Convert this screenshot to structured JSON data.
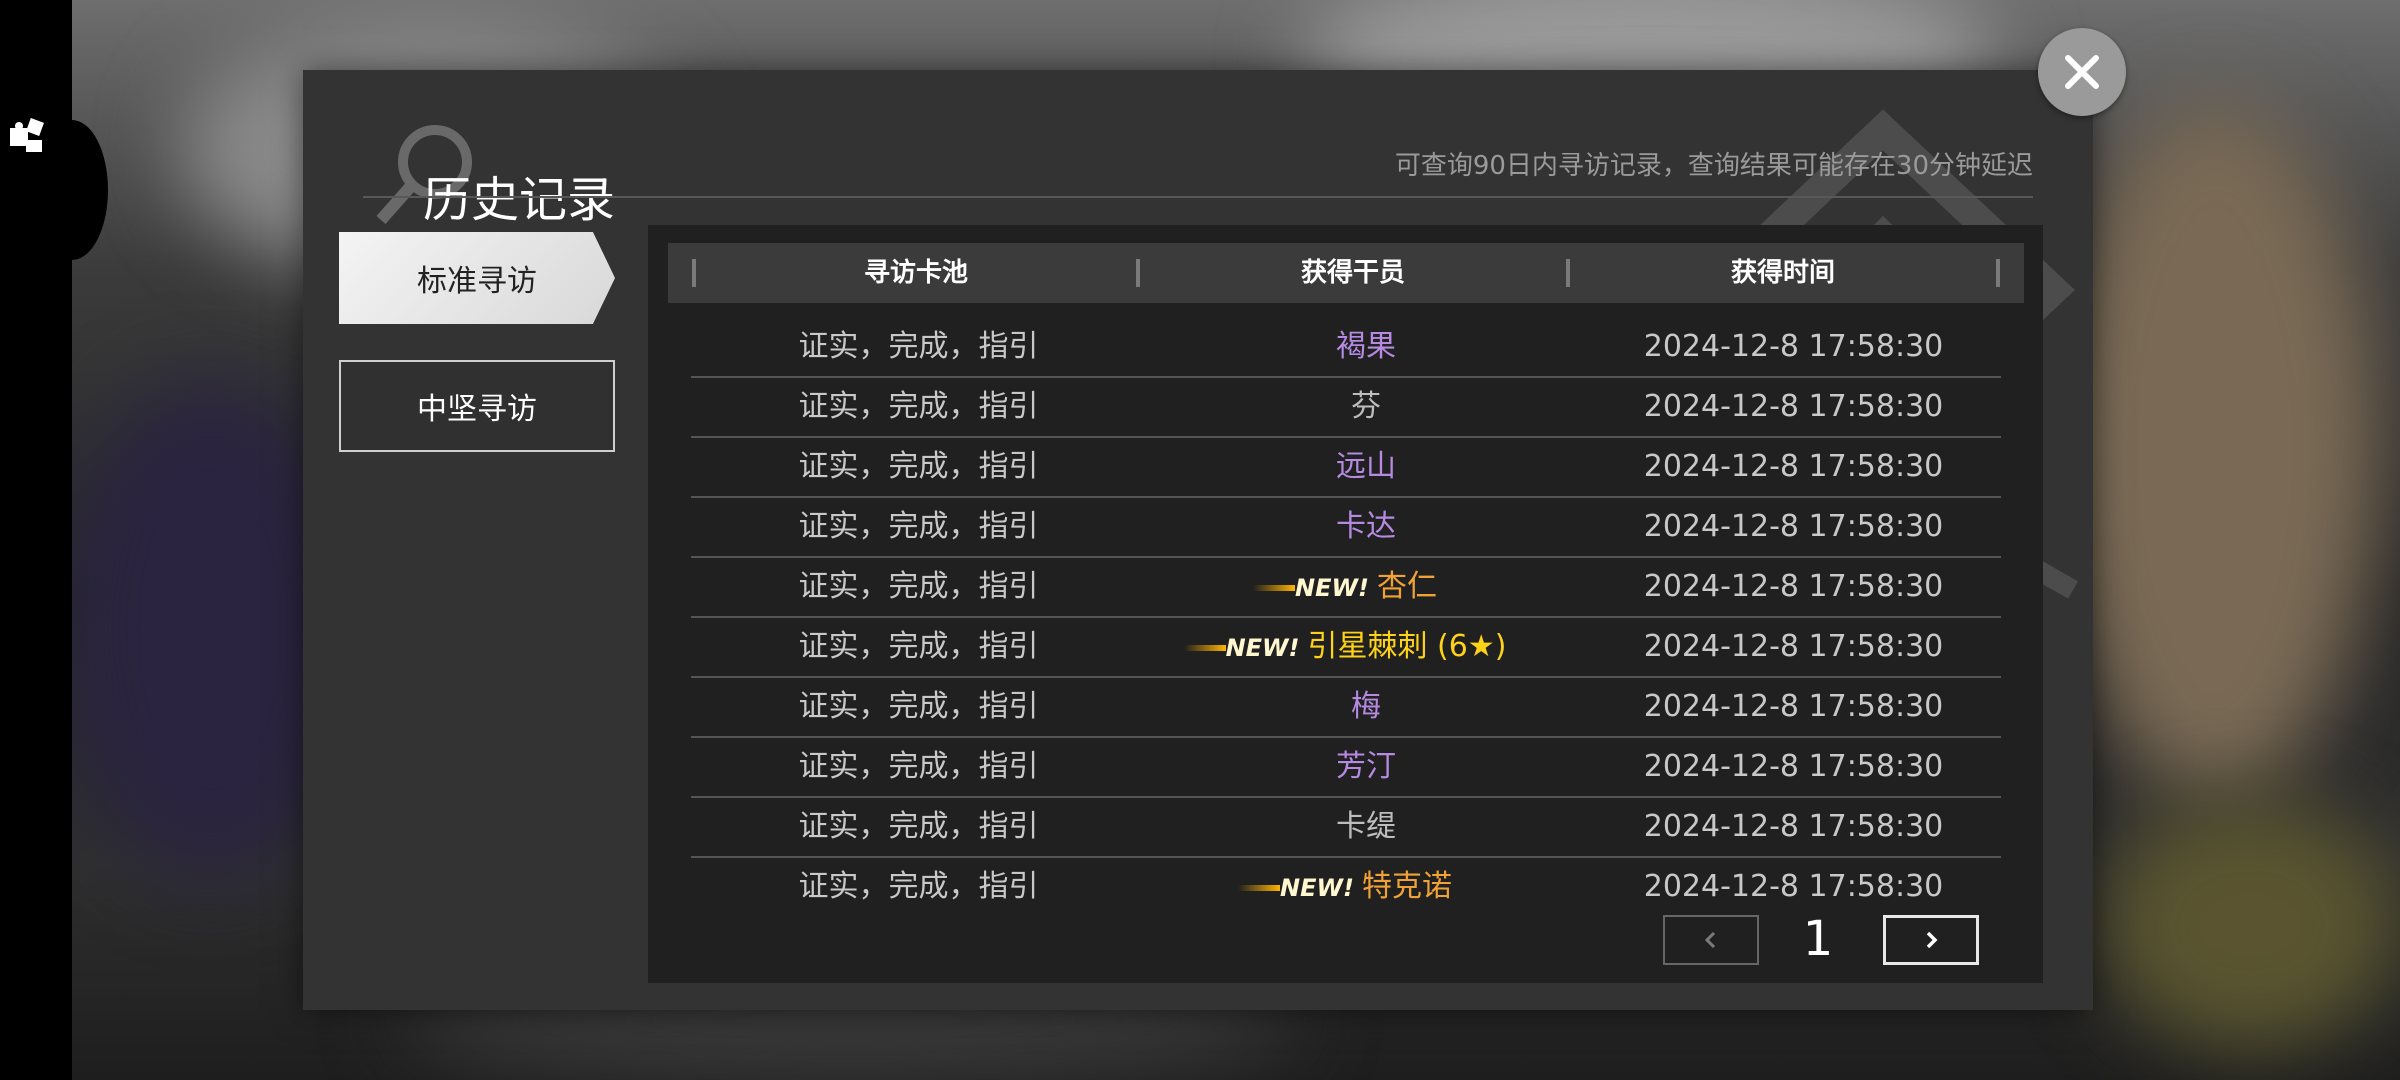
{
  "header": {
    "title": "历史记录",
    "notice": "可查询90日内寻访记录，查询结果可能存在30分钟延迟"
  },
  "tabs": [
    {
      "label": "标准寻访",
      "active": true
    },
    {
      "label": "中坚寻访",
      "active": false
    }
  ],
  "table": {
    "columns": [
      "寻访卡池",
      "获得干员",
      "获得时间"
    ],
    "rows": [
      {
        "pool": "证实，完成，指引",
        "operator": "褐果",
        "time": "2024-12-8 17:58:30",
        "new_label": "",
        "color": "#b58ae0"
      },
      {
        "pool": "证实，完成，指引",
        "operator": "芬",
        "time": "2024-12-8 17:58:30",
        "new_label": "",
        "color": "#bdbdbd"
      },
      {
        "pool": "证实，完成，指引",
        "operator": "远山",
        "time": "2024-12-8 17:58:30",
        "new_label": "",
        "color": "#b58ae0"
      },
      {
        "pool": "证实，完成，指引",
        "operator": "卡达",
        "time": "2024-12-8 17:58:30",
        "new_label": "",
        "color": "#b58ae0"
      },
      {
        "pool": "证实，完成，指引",
        "operator": "杏仁",
        "time": "2024-12-8 17:58:30",
        "new_label": "NEW!",
        "color": "#f0a236"
      },
      {
        "pool": "证实，完成，指引",
        "operator": "引星棘刺 (6★)",
        "time": "2024-12-8 17:58:30",
        "new_label": "NEW!",
        "color": "#ffd21a"
      },
      {
        "pool": "证实，完成，指引",
        "operator": "梅",
        "time": "2024-12-8 17:58:30",
        "new_label": "",
        "color": "#b58ae0"
      },
      {
        "pool": "证实，完成，指引",
        "operator": "芳汀",
        "time": "2024-12-8 17:58:30",
        "new_label": "",
        "color": "#b58ae0"
      },
      {
        "pool": "证实，完成，指引",
        "operator": "卡缇",
        "time": "2024-12-8 17:58:30",
        "new_label": "",
        "color": "#bdbdbd"
      },
      {
        "pool": "证实，完成，指引",
        "operator": "特克诺",
        "time": "2024-12-8 17:58:30",
        "new_label": "NEW!",
        "color": "#f0a236"
      }
    ]
  },
  "pagination": {
    "page": "1"
  },
  "icons": {
    "close": "close-icon",
    "prev": "chevron-left-icon",
    "next": "chevron-right-icon",
    "side": "puzzle-icon"
  }
}
